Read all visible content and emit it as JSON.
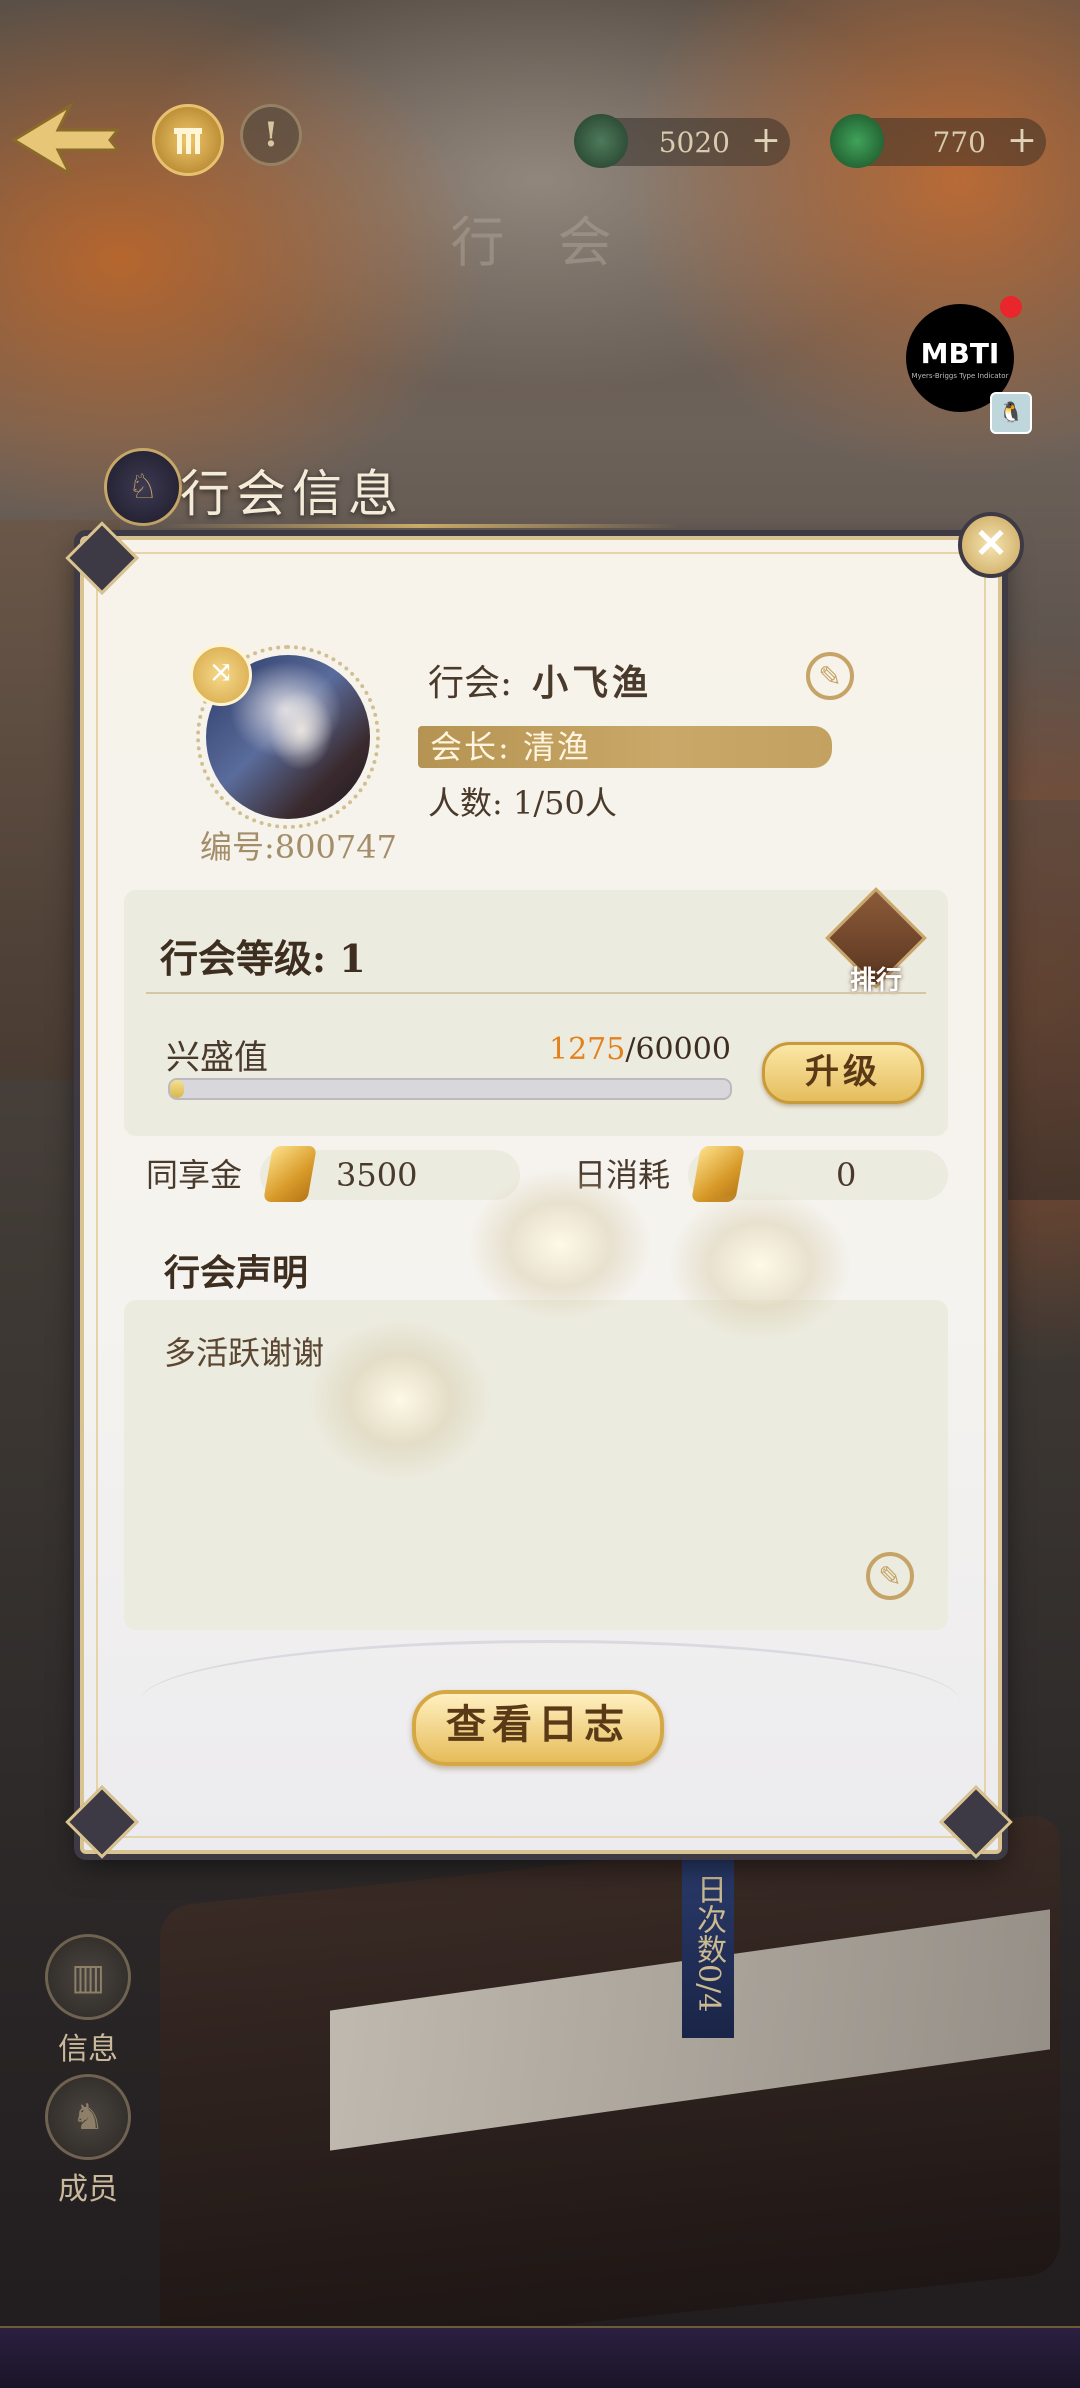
{
  "topbar": {
    "scene_title": "行 会",
    "currency1": {
      "value": "5020",
      "icon": "jade-coin-icon"
    },
    "currency2": {
      "value": "770",
      "icon": "green-orb-icon"
    },
    "plus": "+",
    "help": "!"
  },
  "mbti": {
    "label": "MBTI",
    "sub": "Myers-Briggs Type Indicator"
  },
  "panel": {
    "title": "行会信息",
    "close": "✕",
    "guild_id": "编号:800747",
    "guild_label": "行会:",
    "guild_name": "小飞渔",
    "leader": "会长: 清渔",
    "members": "人数: 1/50人",
    "level": {
      "title": "行会等级: 1",
      "rank_label": "排行",
      "prosperity_label": "兴盛值",
      "prosperity_current": "1275",
      "prosperity_max": "/60000",
      "prosperity_fraction": 0.02125,
      "upgrade_label": "升级"
    },
    "shared_gold": {
      "label": "同享金",
      "value": "3500"
    },
    "daily_cost": {
      "label": "日消耗",
      "value": "0"
    },
    "declaration": {
      "title": "行会声明",
      "text": "多活跃谢谢"
    },
    "view_log": "查看日志"
  },
  "side_menu": [
    {
      "label": "信息",
      "icon": "info-building-icon"
    },
    {
      "label": "成员",
      "icon": "member-horse-icon"
    }
  ],
  "background": {
    "banner": "日次数0/4"
  }
}
